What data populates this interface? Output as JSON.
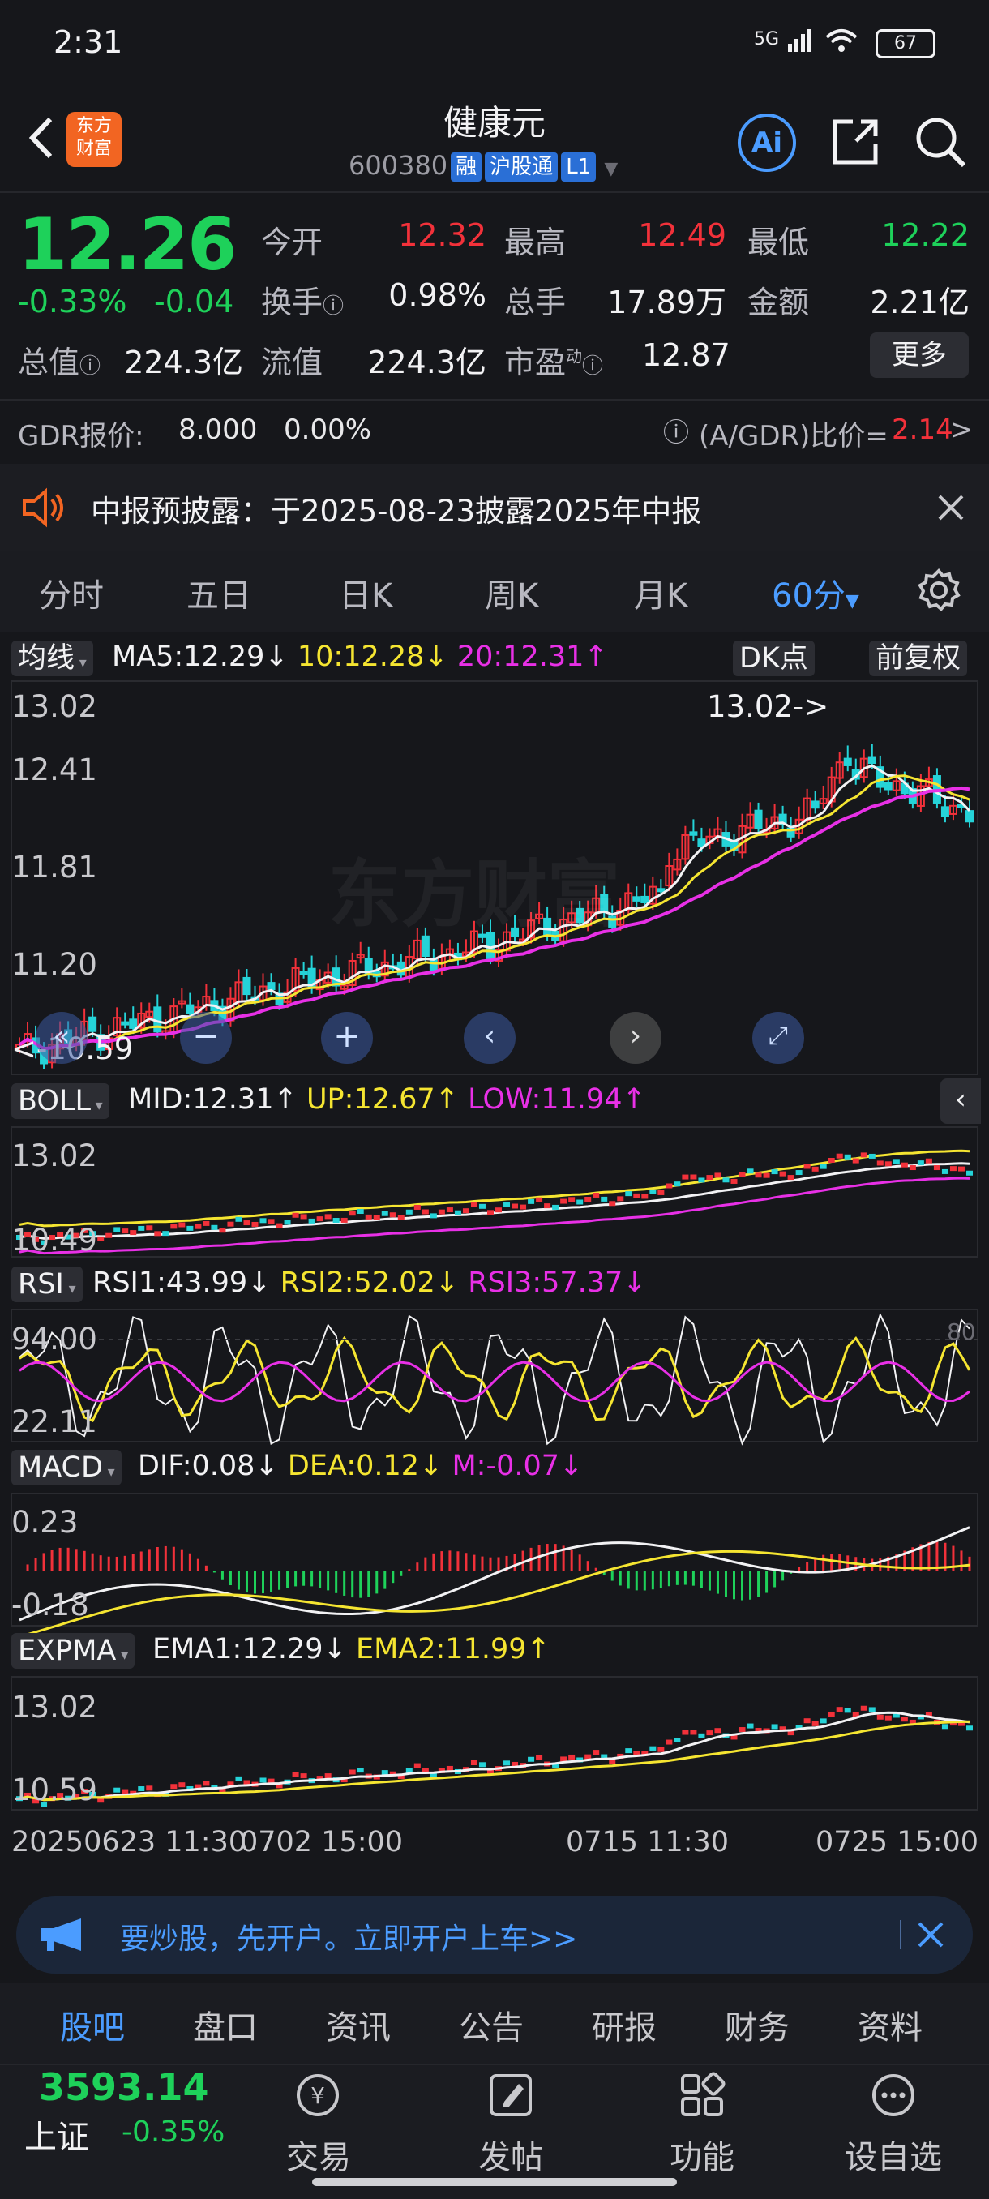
{
  "status_bar": {
    "time": "2:31",
    "signal": "5G",
    "battery": "67"
  },
  "header": {
    "logo_text": "东方财富",
    "title": "健康元",
    "code": "600380",
    "tags": [
      "融",
      "沪股通",
      "L1"
    ],
    "ai_label": "Ai"
  },
  "quote": {
    "price": "12.26",
    "change_pct": "-0.33%",
    "change_abs": "-0.04",
    "fields": {
      "open_label": "今开",
      "open_value": "12.32",
      "high_label": "最高",
      "high_value": "12.49",
      "low_label": "最低",
      "low_value": "12.22",
      "turnover_label": "换手",
      "turnover_value": "0.98%",
      "volume_label": "总手",
      "volume_value": "17.89万",
      "amount_label": "金额",
      "amount_value": "2.21亿",
      "mktcap_label": "总值",
      "mktcap_value": "224.3亿",
      "float_label": "流值",
      "float_value": "224.3亿",
      "pe_label": "市盈",
      "pe_sup": "动",
      "pe_value": "12.87"
    },
    "more_label": "更多"
  },
  "gdr": {
    "label": "GDR报价:",
    "price": "8.000",
    "pct": "0.00%",
    "ratio_label": "(A/GDR)比价=",
    "ratio_value": "2.14",
    "arrow": ">"
  },
  "notice": {
    "text": "中报预披露：于2025-08-23披露2025年中报"
  },
  "period_tabs": [
    "分时",
    "五日",
    "日K",
    "周K",
    "月K",
    "60分"
  ],
  "main_chart": {
    "indicator": "均线",
    "ma5": "MA5:12.29↓",
    "ma10": "10:12.28↓",
    "ma20": "20:12.31↑",
    "dk_label": "DK点",
    "adjust_label": "前复权",
    "y_labels": [
      "13.02",
      "12.41",
      "11.81",
      "11.20"
    ],
    "max_annotation": "13.02->",
    "min_annotation": "<-10.59",
    "watermark": "东方财富"
  },
  "boll": {
    "label": "BOLL",
    "mid": "MID:12.31↑",
    "up": "UP:12.67↑",
    "low": "LOW:11.94↑",
    "y_top": "13.02",
    "y_bottom": "10.49"
  },
  "rsi": {
    "label": "RSI",
    "rsi1": "RSI1:43.99↓",
    "rsi2": "RSI2:52.02↓",
    "rsi3": "RSI3:57.37↓",
    "y_top": "94.00",
    "y_bottom": "22.11",
    "ref": "80"
  },
  "macd": {
    "label": "MACD",
    "dif": "DIF:0.08↓",
    "dea": "DEA:0.12↓",
    "m": "M:-0.07↓",
    "y_top": "0.23",
    "y_bottom": "-0.18"
  },
  "expma": {
    "label": "EXPMA",
    "ema1": "EMA1:12.29↓",
    "ema2": "EMA2:11.99↑",
    "y_top": "13.02",
    "y_bottom": "10.59"
  },
  "x_axis": [
    "20250623 11:30",
    "0702 15:00",
    "0715 11:30",
    "0725 15:00"
  ],
  "ad": {
    "text": "要炒股，先开户。立即开户上车>>"
  },
  "bottom_tabs": [
    "股吧",
    "盘口",
    "资讯",
    "公告",
    "研报",
    "财务",
    "资料"
  ],
  "bottom_nav": {
    "index_value": "3593.14",
    "index_name": "上证",
    "index_pct": "-0.35%",
    "items": [
      "交易",
      "发帖",
      "功能",
      "设自选"
    ],
    "trade_icon_glyph": "¥"
  },
  "colors": {
    "up": "#f2313a",
    "down": "#1ed15a",
    "accent": "#4b9cff",
    "ma10": "#f5e531",
    "ma20": "#e830e6"
  }
}
